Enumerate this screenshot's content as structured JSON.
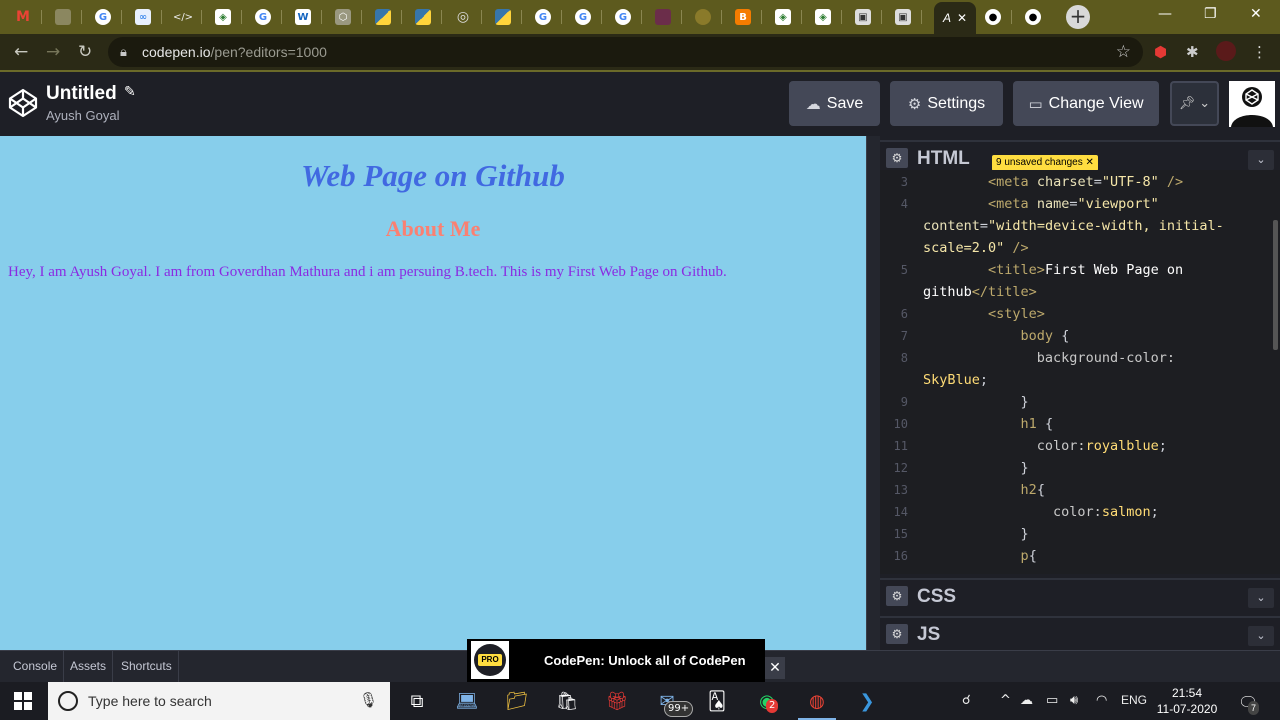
{
  "browser": {
    "url_host": "codepen.io",
    "url_path": "/pen?editors=1000",
    "active_tab_label": "A",
    "tab_icons": [
      "gmail-icon",
      "blank-icon",
      "google-icon",
      "infinity-icon",
      "code-icon",
      "diamond-icon",
      "google-icon",
      "w3-icon",
      "python-icon",
      "python-icon",
      "python-icon",
      "spiral-icon",
      "python-icon",
      "google-icon",
      "google-icon",
      "google-icon",
      "image-icon",
      "frog-icon",
      "blogger-icon",
      "diamond-icon",
      "diamond-icon",
      "contact-icon",
      "contact-icon",
      "codepen-icon",
      "github-icon",
      "github-icon"
    ]
  },
  "codepen": {
    "title": "Untitled",
    "author": "Ayush Goyal",
    "save_label": "Save",
    "settings_label": "Settings",
    "change_view_label": "Change View"
  },
  "preview": {
    "h1": "Web Page on Github",
    "h2": "About Me",
    "p": "Hey, I am Ayush Goyal. I am from Goverdhan Mathura and i am persuing B.tech. This is my First Web Page on Github."
  },
  "editor": {
    "html_label": "HTML",
    "unsaved_badge": "9 unsaved changes",
    "css_label": "CSS",
    "js_label": "JS",
    "line_numbers": [
      "3",
      "4",
      "5",
      "6",
      "7",
      "8",
      "9",
      "10",
      "11",
      "12",
      "13",
      "14",
      "15",
      "16"
    ]
  },
  "bottom": {
    "console": "Console",
    "assets": "Assets",
    "shortcuts": "Shortcuts",
    "promo_badge": "PRO",
    "promo_text": "CodePen: Unlock all of CodePen"
  },
  "taskbar": {
    "search_placeholder": "Type here to search",
    "mail_badge": "99+",
    "whatsapp_badge": "2",
    "language": "ENG",
    "time": "21:54",
    "date": "11-07-2020",
    "notification_count": "7"
  },
  "colors": {
    "preview_bg": "#87ceeb",
    "h1": "#4169e1",
    "h2": "#fa8072",
    "p": "#8a2be2",
    "badge": "#ffdd40"
  }
}
